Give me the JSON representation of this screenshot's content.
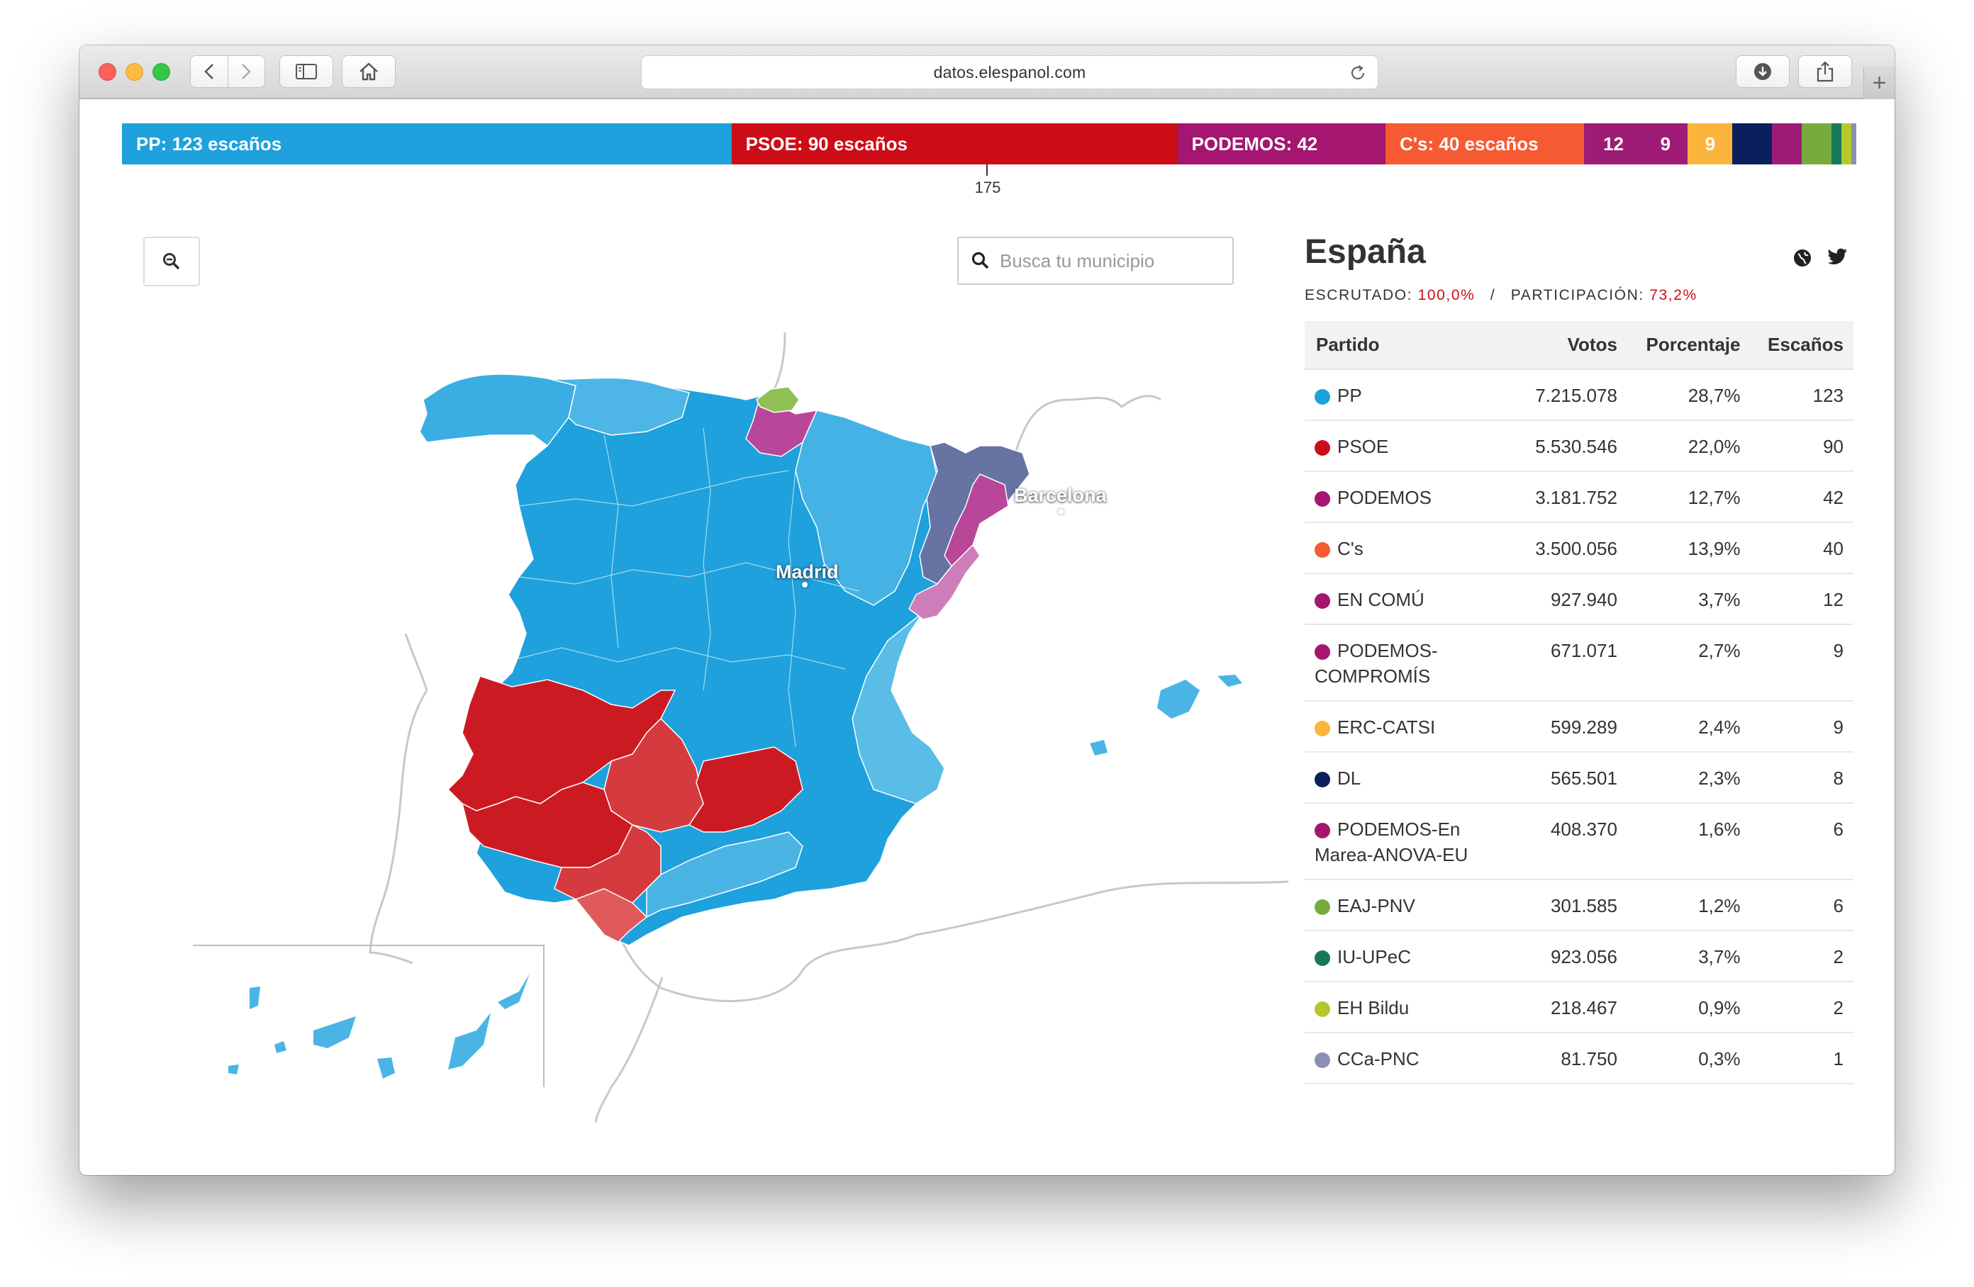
{
  "browser": {
    "url": "datos.elespanol.com",
    "new_tab_label": "+"
  },
  "seat_bar": {
    "segments": [
      {
        "party": "PP",
        "seats": 123,
        "label": "PP: 123 escaños",
        "color": "#1ea1dc"
      },
      {
        "party": "PSOE",
        "seats": 90,
        "label": "PSOE: 90 escaños",
        "color": "#cc0d17"
      },
      {
        "party": "PODEMOS",
        "seats": 42,
        "label": "PODEMOS: 42",
        "color": "#a4166f"
      },
      {
        "party": "C's",
        "seats": 40,
        "label": "C's: 40 escaños",
        "color": "#f55a32"
      },
      {
        "party": "EN COMÚ",
        "seats": 12,
        "label": "12",
        "color": "#9e1c75"
      },
      {
        "party": "PODEMOS-COMPROMÍS",
        "seats": 9,
        "label": "9",
        "color": "#9e1c75"
      },
      {
        "party": "ERC-CATSI",
        "seats": 9,
        "label": "9",
        "color": "#fbb53c"
      },
      {
        "party": "DL",
        "seats": 8,
        "label": "",
        "color": "#0b1f5e"
      },
      {
        "party": "PODEMOS-En Marea-ANOVA-EU",
        "seats": 6,
        "label": "",
        "color": "#9e1c75"
      },
      {
        "party": "EAJ-PNV",
        "seats": 6,
        "label": "",
        "color": "#77ac3d"
      },
      {
        "party": "IU-UPeC",
        "seats": 2,
        "label": "",
        "color": "#16795a"
      },
      {
        "party": "EH Bildu",
        "seats": 2,
        "label": "",
        "color": "#b5c72b"
      },
      {
        "party": "CCa-PNC",
        "seats": 1,
        "label": "",
        "color": "#8b8fb4"
      }
    ],
    "majority_label": "175"
  },
  "map": {
    "search_placeholder": "Busca tu municipio",
    "zoom_icon": "zoom-out-icon",
    "cities": {
      "madrid": "Madrid",
      "barcelona": "Barcelona"
    }
  },
  "results": {
    "region": "España",
    "escrutado_label": "ESCRUTADO:",
    "escrutado_value": "100,0%",
    "separator": "/",
    "participacion_label": "PARTICIPACIÓN:",
    "participacion_value": "73,2%",
    "columns": {
      "party": "Partido",
      "votes": "Votos",
      "percent": "Porcentaje",
      "seats": "Escaños"
    },
    "rows": [
      {
        "party": "PP",
        "votes": "7.215.078",
        "percent": "28,7%",
        "seats": "123",
        "color": "#1ea1dc"
      },
      {
        "party": "PSOE",
        "votes": "5.530.546",
        "percent": "22,0%",
        "seats": "90",
        "color": "#cc0d17"
      },
      {
        "party": "PODEMOS",
        "votes": "3.181.752",
        "percent": "12,7%",
        "seats": "42",
        "color": "#a4166f"
      },
      {
        "party": "C's",
        "votes": "3.500.056",
        "percent": "13,9%",
        "seats": "40",
        "color": "#f55a32"
      },
      {
        "party": "EN COMÚ",
        "votes": "927.940",
        "percent": "3,7%",
        "seats": "12",
        "color": "#a4166f"
      },
      {
        "party": "PODEMOS-COMPROMÍS",
        "votes": "671.071",
        "percent": "2,7%",
        "seats": "9",
        "color": "#a4166f"
      },
      {
        "party": "ERC-CATSI",
        "votes": "599.289",
        "percent": "2,4%",
        "seats": "9",
        "color": "#fbb53c"
      },
      {
        "party": "DL",
        "votes": "565.501",
        "percent": "2,3%",
        "seats": "8",
        "color": "#0b1f5e"
      },
      {
        "party": "PODEMOS-En Marea-ANOVA-EU",
        "votes": "408.370",
        "percent": "1,6%",
        "seats": "6",
        "color": "#a4166f"
      },
      {
        "party": "EAJ-PNV",
        "votes": "301.585",
        "percent": "1,2%",
        "seats": "6",
        "color": "#77ac3d"
      },
      {
        "party": "IU-UPeC",
        "votes": "923.056",
        "percent": "3,7%",
        "seats": "2",
        "color": "#16795a"
      },
      {
        "party": "EH Bildu",
        "votes": "218.467",
        "percent": "0,9%",
        "seats": "2",
        "color": "#b5c72b"
      },
      {
        "party": "CCa-PNC",
        "votes": "81.750",
        "percent": "0,3%",
        "seats": "1",
        "color": "#8b8fb4"
      }
    ]
  }
}
